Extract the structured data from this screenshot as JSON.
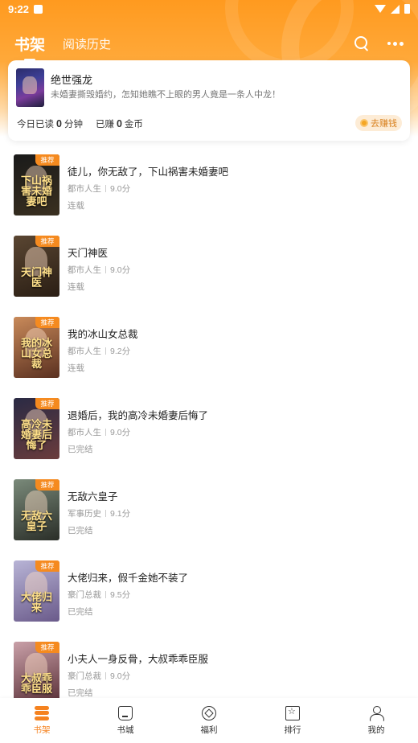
{
  "status_bar": {
    "time": "9:22"
  },
  "header": {
    "tab_active": "书架",
    "tab_history": "阅读历史"
  },
  "reading_card": {
    "title": "绝世强龙",
    "desc": "未婚妻撕毁婚约，怎知她瞧不上眼的男人竟是一条人中龙！",
    "read_prefix": "今日已读",
    "read_value": "0",
    "read_unit": "分钟",
    "earned_prefix": "已赚",
    "earned_value": "0",
    "earned_unit": "金币",
    "earn_button": "去赚钱"
  },
  "books": [
    {
      "title": "徒儿，你无敌了，下山祸害未婚妻吧",
      "genre": "都市人生",
      "score": "9.0分",
      "status": "连载",
      "tag": "推荐",
      "cover_text": "下山祸害未婚妻吧",
      "cover_colors": [
        "#1a1a1a",
        "#3a3020"
      ]
    },
    {
      "title": "天门神医",
      "genre": "都市人生",
      "score": "9.0分",
      "status": "连载",
      "tag": "推荐",
      "cover_text": "天门神医",
      "cover_colors": [
        "#5a4632",
        "#2a1e14"
      ]
    },
    {
      "title": "我的冰山女总裁",
      "genre": "都市人生",
      "score": "9.2分",
      "status": "连载",
      "tag": "推荐",
      "cover_text": "我的冰山女总裁",
      "cover_colors": [
        "#c98a5a",
        "#5a3020"
      ]
    },
    {
      "title": "退婚后，我的高冷未婚妻后悔了",
      "genre": "都市人生",
      "score": "9.0分",
      "status": "已完结",
      "tag": "推荐",
      "cover_text": "高冷未婚妻后悔了",
      "cover_colors": [
        "#2a2a44",
        "#6a3c3c"
      ]
    },
    {
      "title": "无敌六皇子",
      "genre": "军事历史",
      "score": "9.1分",
      "status": "已完结",
      "tag": "推荐",
      "cover_text": "无敌六皇子",
      "cover_colors": [
        "#7a8a7a",
        "#2a2e28"
      ]
    },
    {
      "title": "大佬归来，假千金她不装了",
      "genre": "豪门总裁",
      "score": "9.5分",
      "status": "已完结",
      "tag": "推荐",
      "cover_text": "大佬归来",
      "cover_colors": [
        "#b8b4d6",
        "#6a5a8a"
      ]
    },
    {
      "title": "小夫人一身反骨，大叔乖乖臣服",
      "genre": "豪门总裁",
      "score": "9.0分",
      "status": "已完结",
      "tag": "推荐",
      "cover_text": "大叔乖乖臣服",
      "cover_colors": [
        "#c9a0a8",
        "#5a3038"
      ]
    }
  ],
  "tabbar": [
    {
      "label": "书架",
      "icon": "bookshelf-icon"
    },
    {
      "label": "书城",
      "icon": "store-icon"
    },
    {
      "label": "福利",
      "icon": "welfare-icon"
    },
    {
      "label": "排行",
      "icon": "ranking-icon"
    },
    {
      "label": "我的",
      "icon": "profile-icon"
    }
  ],
  "colors": {
    "accent": "#f5821f",
    "header_start": "#ff9a1f",
    "tag": "#f58a1f"
  }
}
